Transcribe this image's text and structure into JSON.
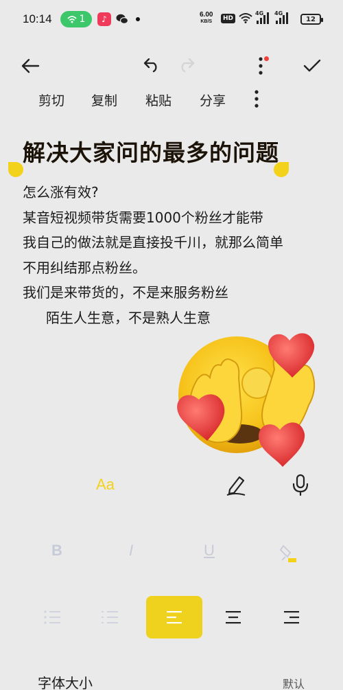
{
  "status_bar": {
    "time": "10:14",
    "hotspot_count": "1",
    "net_speed": "6.00",
    "net_speed_unit": "KB/S",
    "hd_badge": "HD",
    "signal_tag_1": "4G",
    "signal_tag_2": "4G",
    "battery": "12",
    "icons": [
      "hotspot-icon",
      "music-app-icon",
      "wechat-icon",
      "wifi-icon",
      "signal-icon",
      "battery-icon"
    ]
  },
  "toolbar": {
    "icons": [
      "back-arrow-icon",
      "undo-icon",
      "redo-icon",
      "more-vertical-icon",
      "checkmark-icon"
    ],
    "accent_color": "#f0413b"
  },
  "context_menu": {
    "cut": "剪切",
    "copy": "复制",
    "paste": "粘贴",
    "share": "分享"
  },
  "note": {
    "title": "解决大家问的最多的问题",
    "lines": [
      "怎么涨有效?",
      "某音短视频带货需要1000个粉丝才能带",
      "我自己的做法就是直接投千川，就那么简单",
      "不用纠结那点粉丝。",
      "我们是来带货的，不是来服务粉丝",
      "陌生人生意，不是熟人生意"
    ],
    "selection_color": "#f3d21b"
  },
  "format_panel": {
    "font_button": "Aa",
    "style_bold": "B",
    "style_italic": "I",
    "style_underline": "U",
    "active_align": "center",
    "highlight_color": "#efd21e",
    "font_size_label": "字体大小",
    "font_size_value": "默认"
  }
}
